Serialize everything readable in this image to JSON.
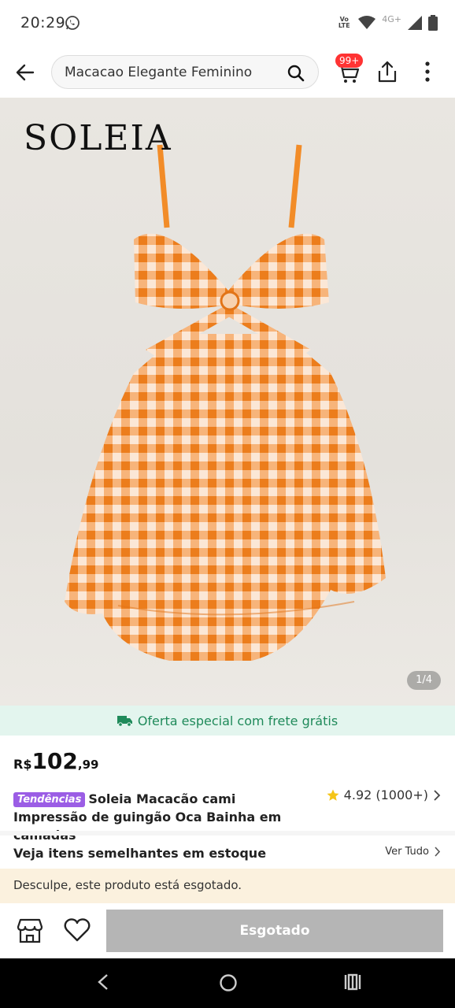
{
  "status": {
    "time": "20:29",
    "network": "Vo LTE",
    "signal_label": "4G+"
  },
  "search": {
    "value": "Macacao Elegante Feminino"
  },
  "cart": {
    "badge": "99+"
  },
  "hero": {
    "brand": "SOLEIA",
    "counter": "1/4"
  },
  "promo": {
    "text": "Oferta especial com frete grátis"
  },
  "price": {
    "currency": "R$",
    "integer": "102",
    "decimal": ",99"
  },
  "product": {
    "tag": "Tendências",
    "title": "Soleia Macacão cami Impressão de guingão Oca Bainha em camadas",
    "rating": "4.92 (1000+)"
  },
  "similar": {
    "label": "Veja itens semelhantes em estoque",
    "link": "Ver Tudo"
  },
  "notice": "Desculpe, este produto está esgotado.",
  "action": {
    "button": "Esgotado"
  },
  "colors": {
    "accent_green": "#1f8a5a",
    "badge_red": "#ff3333",
    "tag_purple": "#9b5de5",
    "dress_orange": "#f28c28"
  }
}
